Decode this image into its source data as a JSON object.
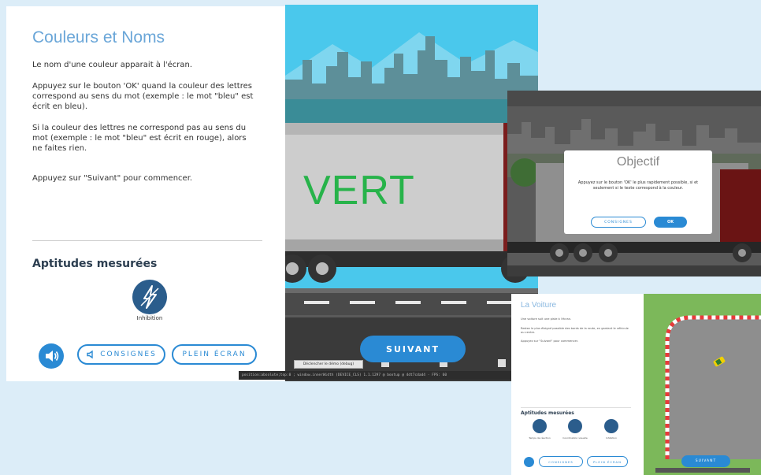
{
  "main_screen": {
    "title": "Couleurs et Noms",
    "paragraphs": [
      "Le nom d'une couleur apparait à l'écran.",
      "Appuyez sur le bouton 'OK' quand la couleur des lettres correspond au sens du mot (exemple : le mot \"bleu\" est écrit en bleu).",
      "Si la couleur des lettres ne correspond pas au sens du mot (exemple : le mot \"bleu\" est écrit en rouge), alors ne faites rien.",
      "Appuyez sur \"Suivant\" pour commencer."
    ],
    "skills_title": "Aptitudes mesurées",
    "skill_label": "Inhibition",
    "consignes_label": "CONSIGNES",
    "plein_ecran_label": "PLEIN ÉCRAN",
    "truck_word": "VERT",
    "suivant_label": "SUIVANT",
    "debug_button": "Déclencher le démo (debug)",
    "debug_bar": "position:absolute;top:0 ; window.innerWidth (DEVICE_CLS)  1.1.1297 @ bootup @ 4dt7cdad4 · FPS: 60"
  },
  "objectif_screen": {
    "title": "Objectif",
    "text": "Appuyez sur le bouton 'OK' le plus rapidement possible, si et seulement si le texte correspond à la couleur.",
    "consignes_label": "CONSIGNES",
    "ok_label": "OK"
  },
  "voiture_screen": {
    "title": "La Voiture",
    "paragraphs": [
      "Une voiture suit une piste à l'écran.",
      "Restez le plus éloigné possible des bords de la route, en gardant le véhicule au centre.",
      "Appuyez sur \"Suivant\" pour commencer."
    ],
    "skills_title": "Aptitudes mesurées",
    "skills": [
      "Temps de réaction",
      "Coordination visuelle",
      "Inhibition"
    ],
    "consignes_label": "CONSIGNES",
    "plein_ecran_label": "PLEIN ÉCRAN",
    "suivant_label": "SUIVANT"
  },
  "colors": {
    "accent_blue": "#2a8ad4",
    "skill_navy": "#2b5d8c",
    "title_blue": "#6aa6d8",
    "word_green": "#27b34a",
    "sky": "#4ac8ec",
    "background": "#dcedf8"
  },
  "icons": [
    "speaker-icon",
    "lightning-icon",
    "gear-icon",
    "car-icon"
  ]
}
